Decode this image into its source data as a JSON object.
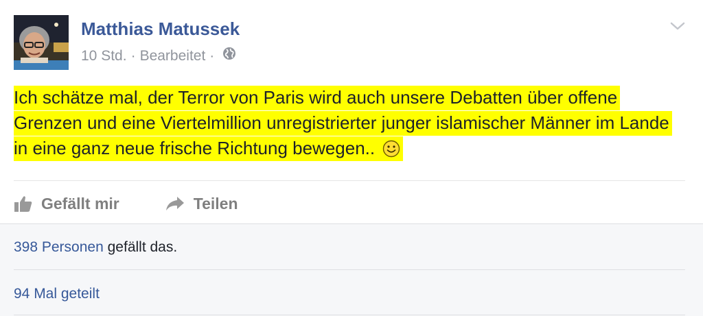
{
  "post": {
    "author": "Matthias Matussek",
    "time": "10 Std.",
    "separator": "·",
    "edited": "Bearbeitet",
    "privacy_icon": "globe-icon",
    "menu_icon": "chevron-down-icon",
    "text": "Ich schätze mal, der Terror von Paris wird auch unsere Debatten über offene Grenzen und eine Viertelmillion unregistrierter junger islamischer Männer im Lande in eine ganz neue frische Richtung bewegen..",
    "text_emoji": "smiley-icon",
    "highlight_color": "#ffff00"
  },
  "actions": {
    "like_label": "Gefällt mir",
    "like_icon": "thumbs-up-icon",
    "share_label": "Teilen",
    "share_icon": "share-arrow-icon"
  },
  "summary": {
    "likes_count_link": "398 Personen",
    "likes_suffix": "gefällt das.",
    "shares": "94 Mal geteilt"
  },
  "colors": {
    "author": "#3b5998",
    "link": "#365899",
    "meta": "#90949c",
    "action": "#7f7f7f"
  }
}
